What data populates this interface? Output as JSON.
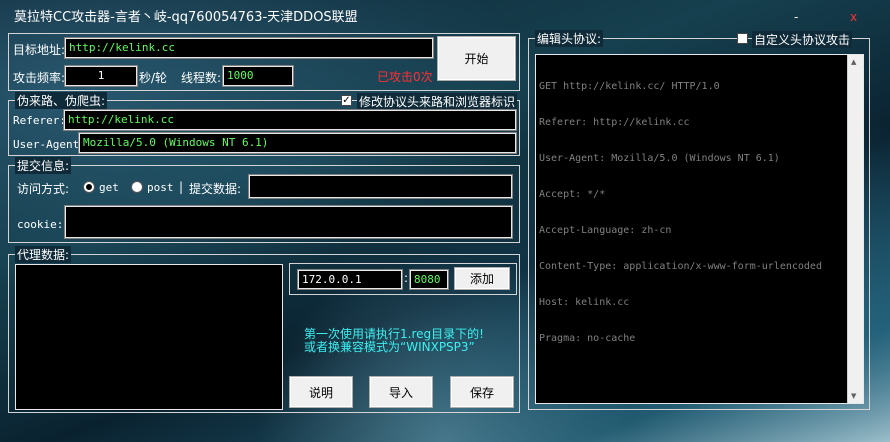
{
  "window": {
    "title": "莫拉特CC攻击器-言者丶岐-qq760054763-天津DDOS联盟",
    "minimize": "-",
    "close": "x"
  },
  "target": {
    "url_label": "目标地址:",
    "url_value": "http://kelink.cc",
    "freq_label": "攻击频率:",
    "freq_value": "1",
    "freq_unit": "秒/轮",
    "threads_label": "线程数:",
    "threads_value": "1000",
    "start_button": "开始",
    "status": "已攻击0次"
  },
  "spoof": {
    "group_label": "伪来路、伪爬虫:",
    "modify_check_label": "修改协议头来路和浏览器标识",
    "referer_label": "Referer:",
    "referer_value": "http://kelink.cc",
    "ua_label": "User-Agent:",
    "ua_value": "Mozilla/5.0 (Windows NT 6.1)"
  },
  "submit": {
    "group_label": "提交信息:",
    "method_label": "访问方式:",
    "get_label": "get",
    "post_label": "post",
    "separator": "|",
    "data_label": "提交数据:",
    "data_value": "",
    "cookie_label": "cookie:",
    "cookie_value": ""
  },
  "proxy": {
    "group_label": "代理数据:",
    "ip_value": "172.0.0.1",
    "colon": ":",
    "port_value": "8080",
    "add_button": "添加",
    "notice_line1": "第一次使用请执行1.reg目录下的!",
    "notice_line2": "或者换兼容模式为“WINXPSP3”",
    "help_button": "说明",
    "import_button": "导入",
    "save_button": "保存"
  },
  "headers": {
    "group_label": "编辑头协议:",
    "custom_check_label": "自定义头协议攻击",
    "lines": [
      "GET http://kelink.cc/ HTTP/1.0",
      "Referer: http://kelink.cc",
      "User-Agent: Mozilla/5.0 (Windows NT 6.1)",
      "Accept: */*",
      "Accept-Language: zh-cn",
      "Content-Type: application/x-www-form-urlencoded",
      "Host: kelink.cc",
      "Pragma: no-cache"
    ]
  },
  "colors": {
    "input_text": "#5cff5c",
    "status_red": "#ff3030",
    "notice_cyan": "#3cf0f0"
  }
}
